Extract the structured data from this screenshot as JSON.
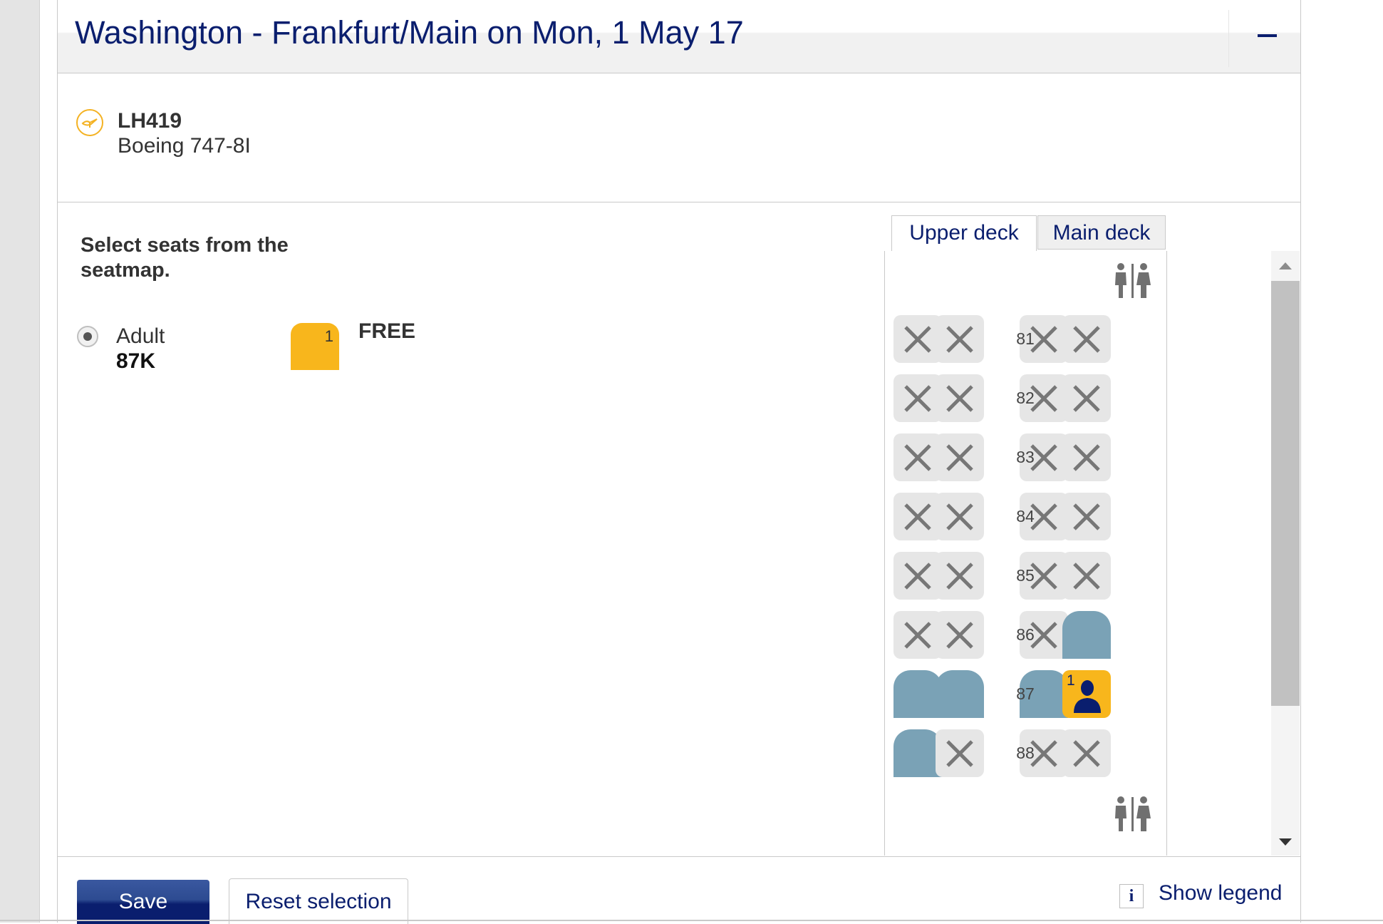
{
  "header": {
    "title": "Washington - Frankfurt/Main on Mon, 1 May 17",
    "collapse_icon": "minus-icon"
  },
  "flight": {
    "logo_icon": "lufthansa-crane-logo",
    "number": "LH419",
    "aircraft": "Boeing 747-8I"
  },
  "selection": {
    "instruction": "Select seats from the seatmap.",
    "passenger": {
      "type": "Adult",
      "seat": "87K",
      "badge_number": "1",
      "price": "FREE",
      "selected": true
    }
  },
  "deck_tabs": [
    {
      "label": "Upper deck",
      "active": true
    },
    {
      "label": "Main deck",
      "active": false
    }
  ],
  "seatmap": {
    "lavatory_icon": "lavatory-icon",
    "rows": [
      {
        "row": "81",
        "seats": [
          "occupied",
          "occupied",
          "occupied",
          "occupied"
        ]
      },
      {
        "row": "82",
        "seats": [
          "occupied",
          "occupied",
          "occupied",
          "occupied"
        ]
      },
      {
        "row": "83",
        "seats": [
          "occupied",
          "occupied",
          "occupied",
          "occupied"
        ]
      },
      {
        "row": "84",
        "seats": [
          "occupied",
          "occupied",
          "occupied",
          "occupied"
        ]
      },
      {
        "row": "85",
        "seats": [
          "occupied",
          "occupied",
          "occupied",
          "occupied"
        ]
      },
      {
        "row": "86",
        "seats": [
          "occupied",
          "occupied",
          "occupied",
          "available"
        ]
      },
      {
        "row": "87",
        "seats": [
          "available",
          "available",
          "available",
          "selected"
        ]
      },
      {
        "row": "88",
        "seats": [
          "available",
          "occupied",
          "occupied",
          "occupied"
        ]
      }
    ],
    "selected_seat_label": "1",
    "colors": {
      "available": "#7aa2b6",
      "selected": "#f8b61c",
      "occupied": "#e6e6e6",
      "brand": "#0a1e6e"
    }
  },
  "footer": {
    "save_label": "Save",
    "reset_label": "Reset selection",
    "legend_icon_text": "i",
    "legend_label": "Show legend"
  }
}
